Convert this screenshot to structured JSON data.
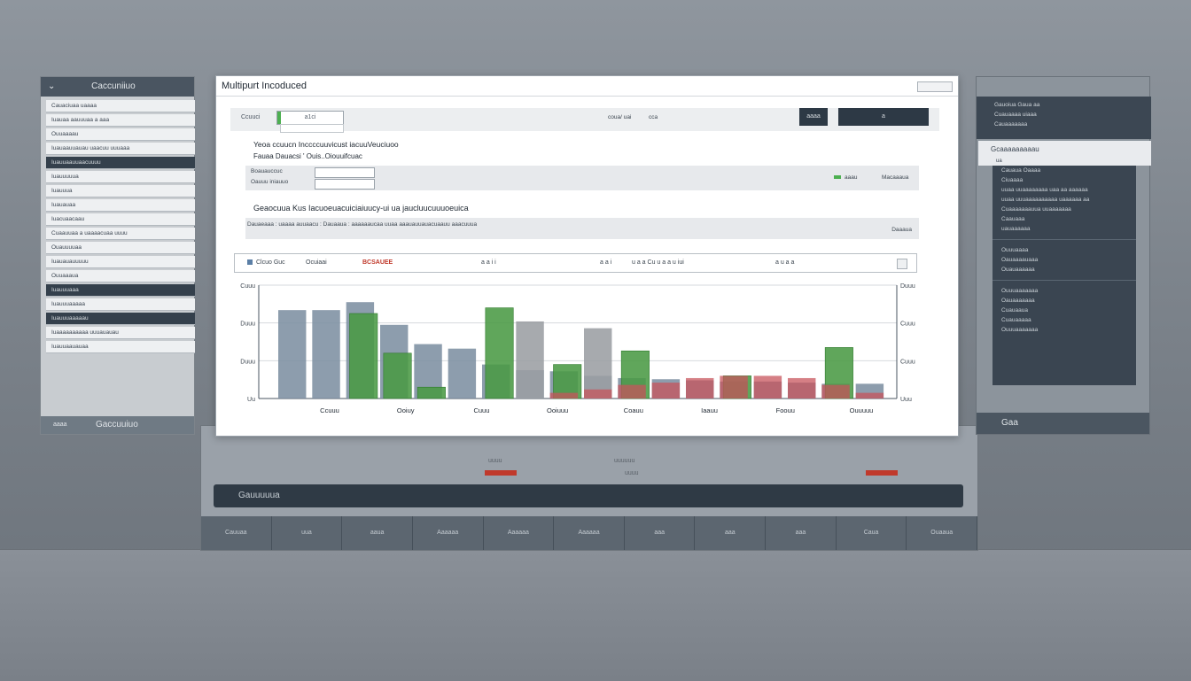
{
  "main_window": {
    "title": "Multipurt Incoduced",
    "toolbar": {
      "label": "Ccuuci",
      "input_value": "a1ci",
      "mid_text": "coua/ uai",
      "mid_text2": "cca",
      "button1": "aaaa",
      "button2": "a"
    },
    "line1": "Yeoa  ccuucn  Inccccuuvicust  iacuuVeuciuoo",
    "line2": "Fauaa   Dauacsi  ' Ouis..Oiouuifcuac",
    "filter": {
      "label1": "Boauauccuc",
      "label2": "Oauuu iniauuo",
      "legend": "aaau",
      "right": "Macaaaua"
    },
    "heading": "Geaocuua   Kus   Iacuoeuacuiciaiuucy-ui ua  jaucluucuuuoeuica",
    "subtext": "Dauaeaaa  :  uaaaa  auuaacu  :  Dauaaua  :   aaaaaaucaa  uuaa  aaauauuauacuaauu  aaacuuua",
    "subtext_right": "Daaaua",
    "legend_bar": {
      "item1": "Clcuo Guc",
      "item2": "Ocuiaai",
      "item3": "BCSAUEE",
      "item4": "a a i i",
      "item5": "a a i",
      "item6": "u a a  Cu u a a  u iui",
      "item7": "a u a a"
    }
  },
  "chart_data": {
    "type": "bar",
    "title": "",
    "xlabel": "",
    "ylabel": "",
    "y_ticks_left": [
      "Cuuu",
      "Duuu",
      "Duuu",
      "Uu"
    ],
    "y_ticks_right": [
      "Duuu",
      "Cuuu",
      "Cuuu",
      "Uuu"
    ],
    "x_labels": [
      "Ccuuu",
      "Ooiuy",
      "Cuuu",
      "Ooiuuu",
      "Coauu",
      "Iaauu",
      "Foouu",
      "Ouuuuu"
    ],
    "ylim": [
      0,
      100
    ],
    "series": [
      {
        "name": "",
        "color": "#7d8fa2",
        "values": [
          78,
          78,
          85,
          65,
          48,
          44,
          30,
          25,
          24,
          20,
          18,
          17,
          16,
          15,
          15,
          14,
          13,
          13
        ]
      },
      {
        "name": "",
        "color": "#4a9a44",
        "values": [
          0,
          0,
          75,
          40,
          10,
          0,
          80,
          0,
          30,
          0,
          42,
          0,
          0,
          20,
          0,
          0,
          45,
          0
        ]
      },
      {
        "name": "",
        "color": "#9b9ea3",
        "values": [
          0,
          0,
          0,
          0,
          0,
          0,
          0,
          68,
          0,
          62,
          0,
          0,
          0,
          0,
          0,
          0,
          0,
          0
        ]
      },
      {
        "name": "",
        "color": "#c7545c",
        "values": [
          0,
          0,
          0,
          0,
          0,
          0,
          0,
          0,
          5,
          8,
          12,
          14,
          18,
          20,
          20,
          18,
          12,
          5
        ]
      }
    ]
  },
  "left_panel": {
    "title": "Caccuniiuo",
    "items": [
      "Cauaciuaa uaaaa",
      "Iuauaa aauuuaa  a aaa",
      "Ouuaaaau",
      "Iuauaauuauau uaacuu  uuuaaa",
      "Iuauuaauuaacuuuu",
      "Iuauuuuua",
      "Iuauuua",
      "Iuauauaa",
      "Iuacuaacaau",
      "Cuaauuaa  a uaaaacuaa uuuu",
      "Ouauuuuaa",
      "Iuauauauuuuu",
      "Ouuaaaua",
      "Iuauuuaaa",
      "Iuauuuaaaaa",
      "Iuauuuaaaaau",
      "Iuaaaaaaaaaa  uuuauauau",
      "Iuauuaauauaa"
    ],
    "footer_small": "aaaa",
    "footer": "Gaccuuiuo"
  },
  "right_panel": {
    "top_rows": [
      "Gauoiua Gaua aa",
      "Cuauaaaa  uiaaa",
      "Cauaaaaaaa"
    ],
    "tab": "Gcaaaaaaaaau",
    "tab_sub": "ua",
    "rows": [
      "Cauaua Oaaaa",
      "Ciuaaaa",
      "uuaa uuaaaaaaaa uaa  aa  aaaaaa",
      "uuaa  uuuaaaaaaaaaa uaaaaaa  aa",
      "Cuaaaaaaauua uuaaaaaaa",
      "Caauaaa",
      "uauaaaaaa",
      "Ouuuaaaa",
      "Oauaaaauaaa",
      "Ouauaaaaaa",
      "Ouuuaaaaaaa",
      "Oauaaaaaaa",
      "Cuauaaua",
      "Cuauaaaaa",
      "Ouuuaaaaaaa"
    ],
    "footer": "Gaa"
  },
  "back_console": {
    "bar_label": "Gauuuuua",
    "ticker1": "uuuu",
    "ticker2": "uuuuuu",
    "ticker3": "uuuu",
    "ticker4": "uuuuuu",
    "footer_cells": [
      "Cauuaa",
      "uua",
      "aaua",
      "Aaaaaa",
      "Aaaaaa",
      "Aaaaaa",
      "aaa",
      "aaa",
      "aaa",
      "Caua",
      "Ouaaua"
    ]
  }
}
